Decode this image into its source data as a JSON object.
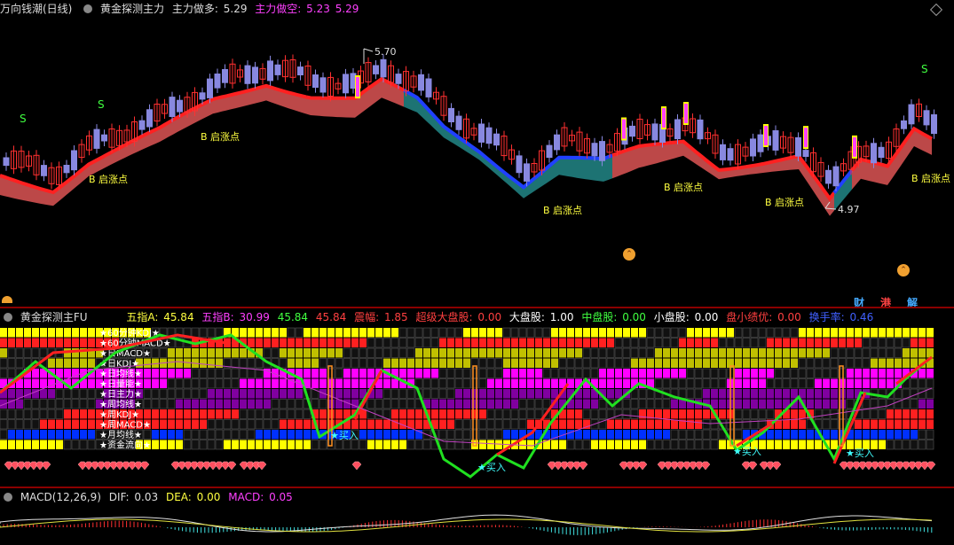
{
  "main": {
    "title": "万向钱潮(日线)",
    "indicator": "黄金探测主力",
    "long_label": "主力做多:",
    "long_value": "5.29",
    "short_label": "主力做空:",
    "short_value": "5.23",
    "short_value2": "5.29",
    "high_label": "5.70",
    "low_label": "4.97",
    "buy_point_label": "B 启涨点",
    "sell_label": "S",
    "colors": {
      "up": "#ff3030",
      "down": "#8080e0",
      "ribbon_up": "#ff2020",
      "ribbon_down": "#008080",
      "blue": "#2040ff"
    }
  },
  "tabs": {
    "cai": "财",
    "gang": "港",
    "jie": "解"
  },
  "fu": {
    "title": "黄金探测主FU",
    "wuzhiA_label": "五指A:",
    "wuzhiA": "45.84",
    "wuzhiB_label": "五指B:",
    "wuzhiB": "30.99",
    "v3": "45.84",
    "v4": "45.84",
    "zhenfu_label": "震幅:",
    "zhenfu": "1.85",
    "chaoji_label": "超级大盘股:",
    "chaoji": "0.00",
    "dapan_label": "大盘股:",
    "dapan": "1.00",
    "zhongpan_label": "中盘股:",
    "zhongpan": "0.00",
    "xiaopan_label": "小盘股:",
    "xiaopan": "0.00",
    "panxiao_label": "盘小绩优:",
    "panxiao": "0.00",
    "huanshou_label": "换手率:",
    "huanshou": "0.46",
    "buy_label": "买入",
    "row_labels": [
      "60分钟KDJ",
      "60分钟MACD",
      "日MACD",
      "日KDJ",
      "日均线",
      "日量能",
      "日主力",
      "周均线",
      "周KDJ",
      "周MACD",
      "月均线",
      "资金流向"
    ]
  },
  "macd": {
    "title": "MACD(12,26,9)",
    "dif_label": "DIF:",
    "dif": "0.03",
    "dea_label": "DEA:",
    "dea": "0.00",
    "macd_label": "MACD:",
    "macd": "0.05"
  }
}
